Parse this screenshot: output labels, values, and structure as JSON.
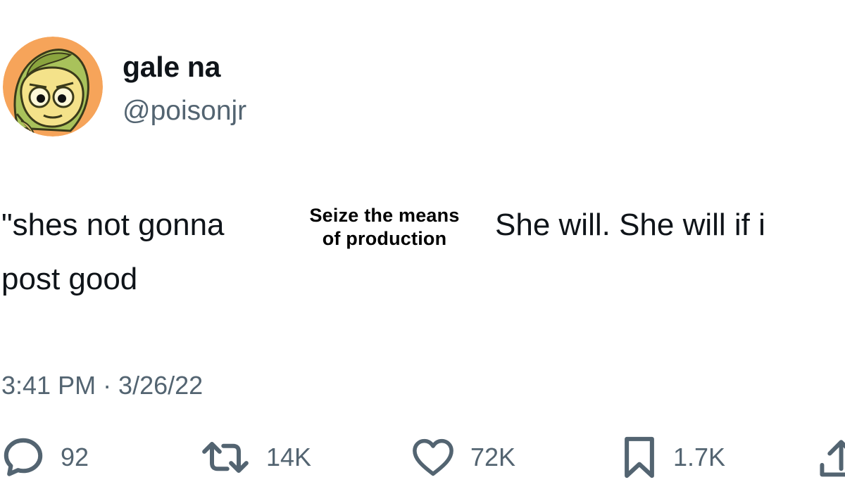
{
  "user": {
    "display_name": "gale na",
    "handle": "@poisonjr"
  },
  "tweet": {
    "text_part1": "\"shes not gonna",
    "caption_line1": "Seize the means",
    "caption_line2": "of production",
    "text_part2": "She will. She will if i",
    "text_part3": "post good",
    "timestamp": "3:41 PM · 3/26/22"
  },
  "actions": {
    "replies": "92",
    "retweets": "14K",
    "likes": "72K",
    "bookmarks": "1.7K"
  },
  "icons": {
    "reply": "reply-icon",
    "retweet": "retweet-icon",
    "like": "heart-icon",
    "bookmark": "bookmark-icon",
    "share": "share-icon"
  },
  "colors": {
    "text": "#0f1419",
    "secondary": "#536471",
    "avatar_bg": "#f6a45a"
  }
}
